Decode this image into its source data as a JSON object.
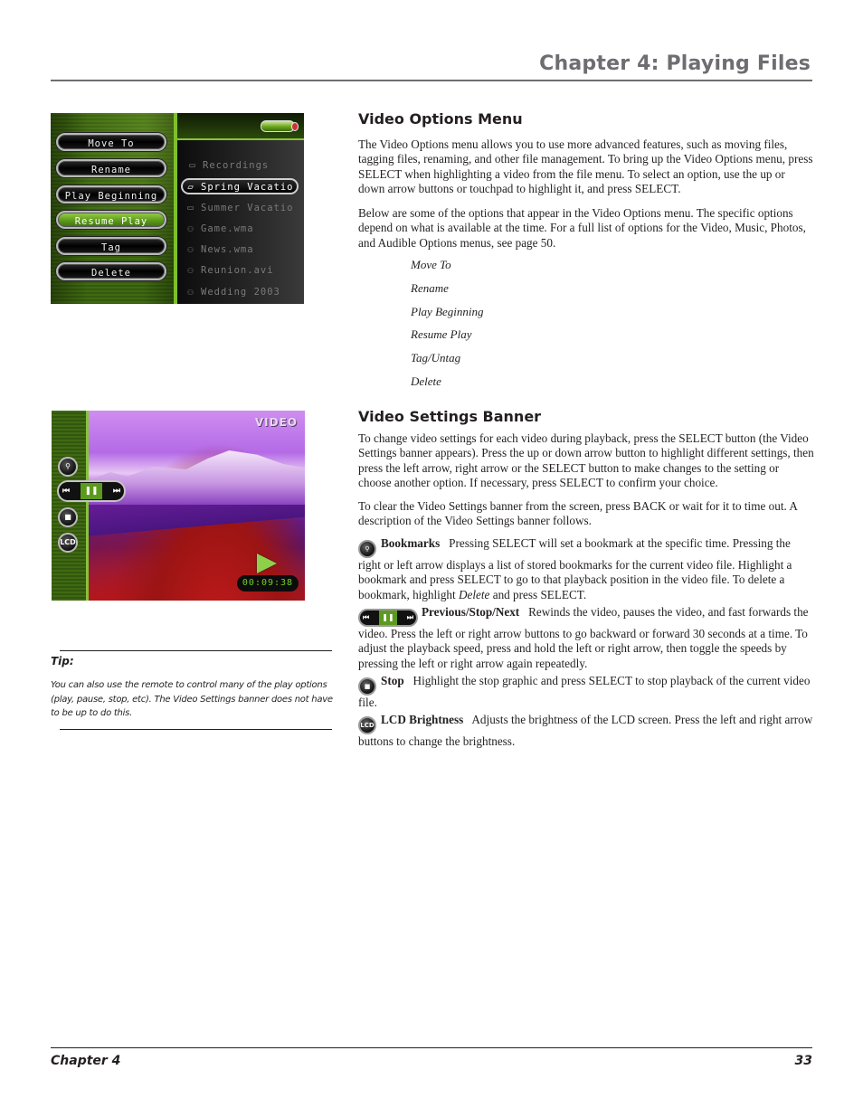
{
  "header": {
    "chapter_title": "Chapter 4: Playing Files"
  },
  "options_menu_screen": {
    "menu_buttons": [
      {
        "label": "Move To",
        "active": false
      },
      {
        "label": "Rename",
        "active": false
      },
      {
        "label": "Play Beginning",
        "active": false
      },
      {
        "label": "Resume Play",
        "active": true
      },
      {
        "label": "Tag",
        "active": false
      },
      {
        "label": "Delete",
        "active": false
      }
    ],
    "files": [
      {
        "icon": "folder-icon",
        "name": "Recordings",
        "selected": false
      },
      {
        "icon": "folder-open-icon",
        "name": "Spring Vacatio",
        "selected": true
      },
      {
        "icon": "folder-icon",
        "name": "Summer Vacatio",
        "selected": false
      },
      {
        "icon": "video-camera-icon",
        "name": "Game.wma",
        "selected": false
      },
      {
        "icon": "video-camera-icon",
        "name": "News.wma",
        "selected": false
      },
      {
        "icon": "video-camera-icon",
        "name": "Reunion.avi",
        "selected": false
      },
      {
        "icon": "video-camera-icon",
        "name": "Wedding 2003",
        "selected": false
      }
    ]
  },
  "video_screen": {
    "label": "VIDEO",
    "timecode": "00:09:38",
    "lcd_label": "LCD",
    "transport": {
      "prev": "⏮",
      "pause": "❚❚",
      "next": "⏭"
    }
  },
  "video_options": {
    "heading": "Video Options Menu",
    "para1": "The Video Options menu allows you to use more advanced features, such as moving files, tagging files, renaming, and other file management. To bring up the Video Options menu, press SELECT when highlighting a video from the file menu. To select an option, use the up or down arrow buttons or touchpad to highlight it, and press SELECT.",
    "para2": "Below are some of the options that appear in the Video Options menu. The specific options depend on what is available at the time. For a full list of options for the Video, Music, Photos, and Audible Options menus, see page 50.",
    "options": [
      "Move To",
      "Rename",
      "Play Beginning",
      "Resume Play",
      "Tag/Untag",
      "Delete"
    ]
  },
  "video_settings": {
    "heading": "Video Settings Banner",
    "para1": "To change video settings for each video during playback, press the SELECT button (the Video Settings banner appears). Press the up or down arrow button to highlight different settings, then press the left arrow, right arrow or the SELECT button to make changes to the setting or choose another option. If necessary, press SELECT to confirm your choice.",
    "para2": "To clear the Video Settings banner from the screen, press BACK or wait for it to time out. A description of the Video Settings banner follows.",
    "items": [
      {
        "term": "Bookmarks",
        "text_before": "Pressing SELECT will set a bookmark at the specific time. Pressing the right or left arrow displays a list of stored bookmarks for the current video file. Highlight a bookmark and press SELECT to go to that playback position in the video file. To delete a bookmark, highlight ",
        "text_italic": "Delete",
        "text_after": " and press SELECT."
      },
      {
        "term": "Previous/Stop/Next",
        "text": "Rewinds the video, pauses the video, and fast forwards the video. Press the left or right arrow buttons to go backward or forward 30 seconds at a time. To adjust the playback speed, press and hold the left or right arrow, then toggle the speeds by pressing the left or right arrow again repeatedly."
      },
      {
        "term": "Stop",
        "text": "Highlight the stop graphic and press SELECT to stop playback of the current video file."
      },
      {
        "term": "LCD Brightness",
        "text": "Adjusts the brightness of the LCD screen. Press the left and right arrow buttons to change the brightness."
      }
    ]
  },
  "tip": {
    "label": "Tip:",
    "text": "You can also use the remote to control many of the play options (play, pause, stop, etc). The Video Settings banner does not have to be up to do this."
  },
  "footer": {
    "chapter": "Chapter 4",
    "page_number": "33"
  }
}
